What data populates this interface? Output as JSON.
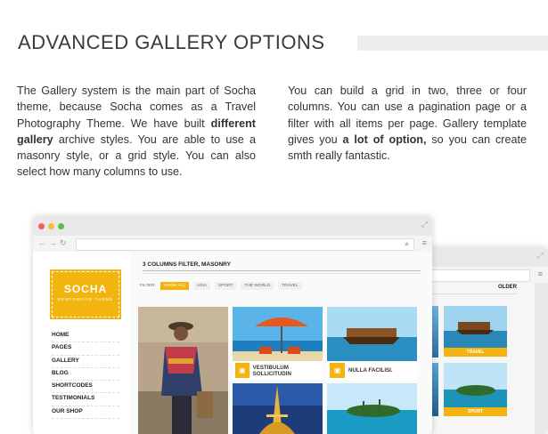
{
  "header": {
    "title": "ADVANCED GALLERY OPTIONS"
  },
  "intro": {
    "left": {
      "p1": "The Gallery system is the main part of Socha theme, because Socha comes as a Travel Photography Theme. We have built ",
      "b1": "different gallery",
      "p2": " archive styles. You are able to use a masonry style, or a grid style. You can also select how many columns to use."
    },
    "right": {
      "p1": "You can build a grid in two, three or four columns. You can use a pagination page or a filter with all items per page. Gallery template gives you ",
      "b1": "a lot of option,",
      "p2": " so you can create smth really fantastic."
    }
  },
  "browser": {
    "logo": {
      "name": "SOCHA",
      "tagline": "RESPONSIVE THEME"
    },
    "menu": [
      "HOME",
      "PAGES",
      "GALLERY",
      "BLOG",
      "SHORTCODES",
      "TESTIMONIALS",
      "OUR SHOP"
    ],
    "main_title": "3 COLUMNS FILTER, MASONRY",
    "filter_label": "FILTER:",
    "filters": [
      "SHOW ALL",
      "ASIA",
      "SPORT",
      "THE WORLD",
      "TRAVEL"
    ],
    "captions": [
      "VESTIBULUM SOLLICITUDIN",
      "NULLA FACILISI."
    ]
  },
  "back_browser": {
    "older_label": "OLDER",
    "captions": [
      "TRAVEL",
      "SPORT"
    ]
  },
  "colors": {
    "accent": "#f4b40f",
    "header_bar": "#eeeeee"
  },
  "icons": [
    "image-icon",
    "star-icon",
    "menu-icon",
    "expand-icon",
    "back-arrow-icon",
    "forward-arrow-icon",
    "reload-icon"
  ]
}
